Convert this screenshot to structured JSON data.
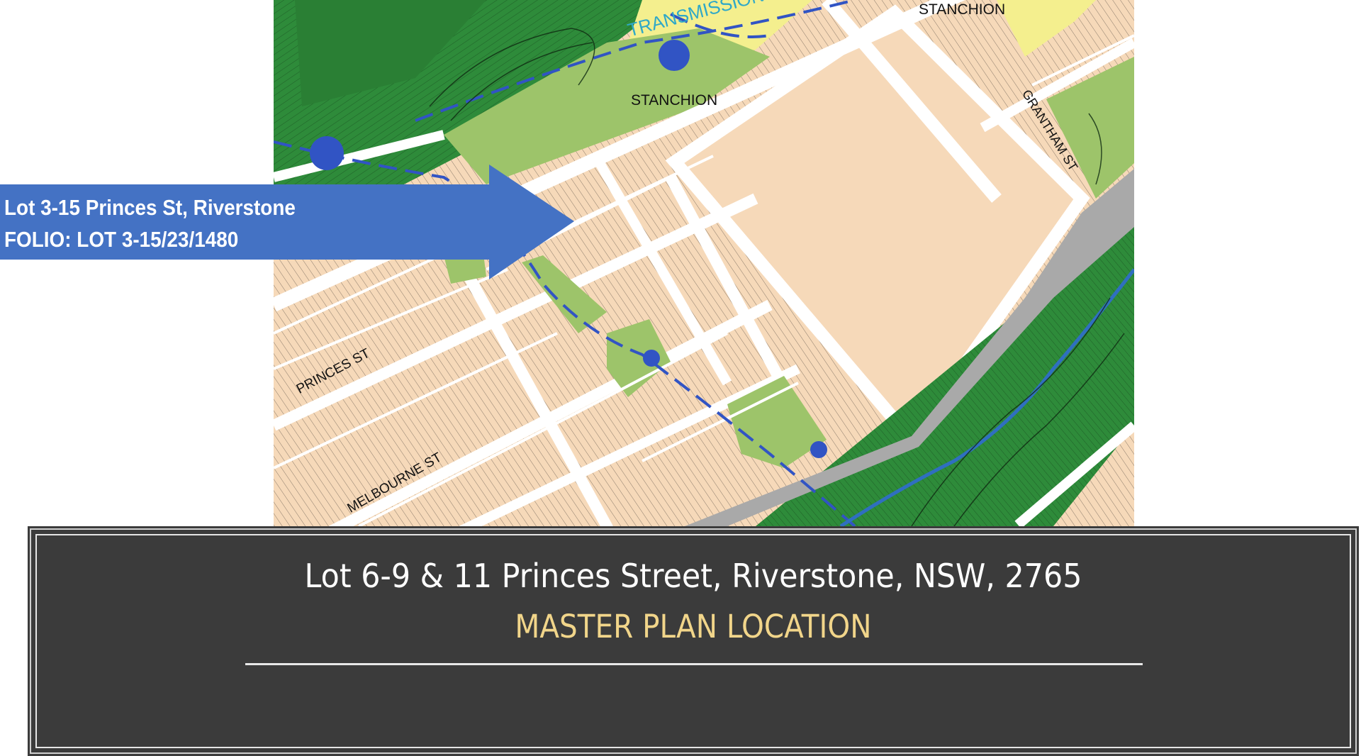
{
  "map": {
    "labels": {
      "transmission_easement": "TRANSMISSION EASEMENT",
      "stanchion_top": "STANCHION",
      "stanchion_mid": "STANCHION",
      "princes_st": "PRINCES ST",
      "melbourne_st": "MELBOURNE ST",
      "grantham_st": "GRANTHAM ST"
    },
    "colors": {
      "residential": "#f6d9b9",
      "open_space": "#9dc46a",
      "bushland": "#2e8b3a",
      "easement": "#f4ef8e",
      "road": "#ffffff",
      "rail": "#a9a9a9",
      "water": "#3154c4"
    }
  },
  "callout": {
    "line1": "Lot 3-15 Princes St, Riverstone",
    "line2": "FOLIO: LOT 3-15/23/1480",
    "color": "#4472c4"
  },
  "info_panel": {
    "address": "Lot 6-9 & 11 Princes Street, Riverstone, NSW, 2765",
    "title": "MASTER PLAN LOCATION"
  }
}
